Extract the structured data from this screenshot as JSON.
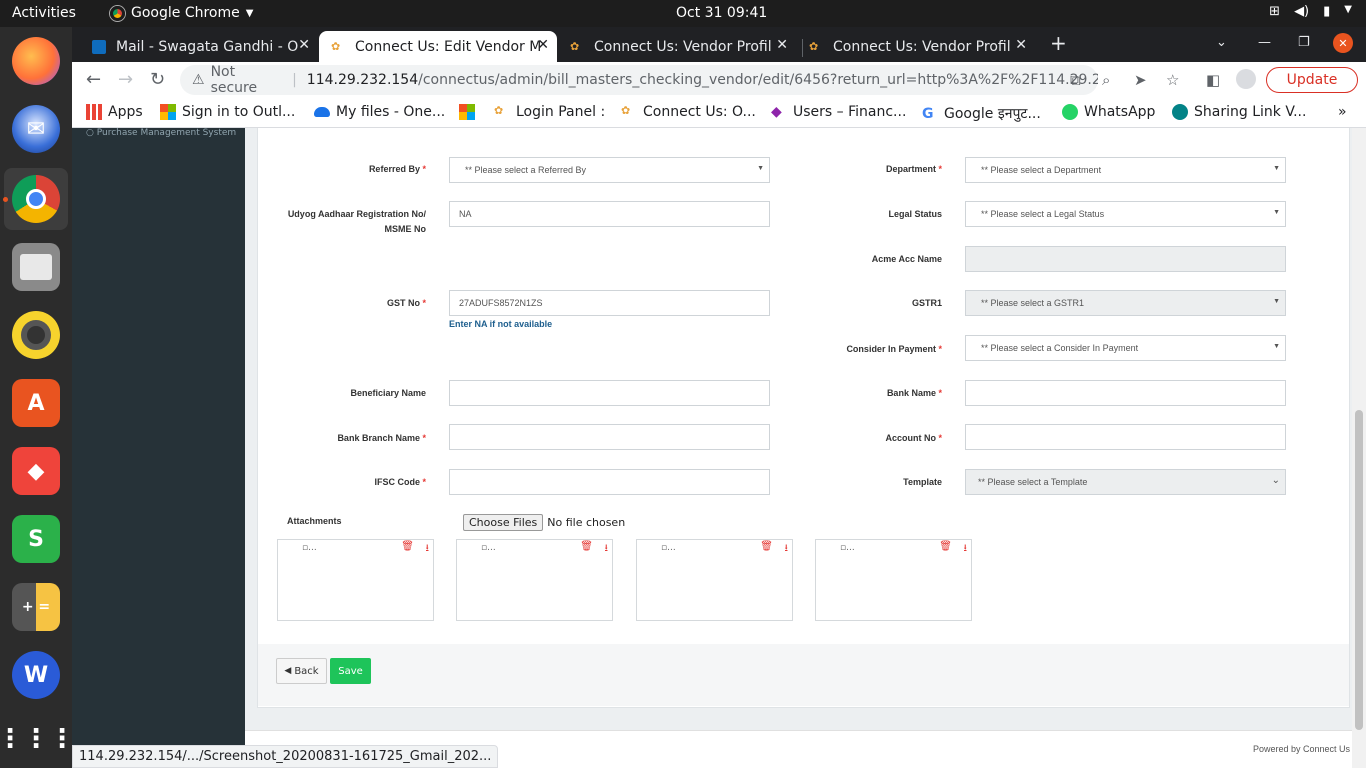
{
  "system": {
    "activities": "Activities",
    "app_name": "Google Chrome",
    "clock": "Oct 31  09:41"
  },
  "tabs": [
    {
      "title": "Mail - Swagata Gandhi - O",
      "active": false
    },
    {
      "title": "Connect Us: Edit Vendor M",
      "active": true
    },
    {
      "title": "Connect Us: Vendor Profil",
      "active": false
    },
    {
      "title": "Connect Us: Vendor Profil",
      "active": false
    }
  ],
  "omnibox": {
    "not_secure": "Not secure",
    "host": "114.29.232.154",
    "path": "/connectus/admin/bill_masters_checking_vendor/edit/6456?return_url=http%3A%2F%2F114.29.232....",
    "update_label": "Update"
  },
  "bookmarks": [
    {
      "label": "Apps",
      "icon": "apps-grid-icon"
    },
    {
      "label": "Sign in to Outl...",
      "icon": "microsoft-icon"
    },
    {
      "label": "My files - One...",
      "icon": "onedrive-icon"
    },
    {
      "label": "",
      "icon": "microsoft-icon"
    },
    {
      "label": "Login Panel :",
      "icon": "connectus-icon"
    },
    {
      "label": "Connect Us: O...",
      "icon": "connectus-icon"
    },
    {
      "label": "Users – Financ...",
      "icon": "diamond-icon"
    },
    {
      "label": "Google इनपुट...",
      "icon": "google-icon"
    },
    {
      "label": "WhatsApp",
      "icon": "whatsapp-icon"
    },
    {
      "label": "Sharing Link V...",
      "icon": "sharepoint-icon"
    }
  ],
  "sidebar": {
    "item": "Purchase Management System"
  },
  "form": {
    "referred_by": {
      "label": "Referred By",
      "value": "** Please select a Referred By"
    },
    "department": {
      "label": "Department",
      "value": "** Please select a Department"
    },
    "udyog": {
      "label_line1": "Udyog Aadhaar Registration No/",
      "label_line2": "MSME No",
      "value": "NA"
    },
    "legal_status": {
      "label": "Legal Status",
      "value": "** Please select a Legal Status"
    },
    "acme_acc_name": {
      "label": "Acme Acc Name",
      "value": ""
    },
    "gst_no": {
      "label": "GST No",
      "value": "27ADUFS8572N1ZS",
      "hint": "Enter NA if not available"
    },
    "gstr1": {
      "label": "GSTR1",
      "value": "** Please select a GSTR1"
    },
    "consider_in_payment": {
      "label": "Consider In Payment",
      "value": "** Please select a Consider In Payment"
    },
    "beneficiary_name": {
      "label": "Beneficiary Name",
      "value": ""
    },
    "bank_name": {
      "label": "Bank Name",
      "value": ""
    },
    "bank_branch_name": {
      "label": "Bank Branch Name",
      "value": ""
    },
    "account_no": {
      "label": "Account No",
      "value": ""
    },
    "ifsc_code": {
      "label": "IFSC Code",
      "value": ""
    },
    "template": {
      "label": "Template",
      "value": "** Please select a Template"
    },
    "attachments": {
      "label": "Attachments",
      "choose_label": "Choose Files",
      "no_file": "No file chosen",
      "broken_alt": "..."
    },
    "required_mark": "*"
  },
  "actions": {
    "back": "Back",
    "save": "Save"
  },
  "footer": {
    "powered_by": "Powered by Connect Us"
  },
  "status_url": "114.29.232.154/.../Screenshot_20200831-161725_Gmail_202..."
}
